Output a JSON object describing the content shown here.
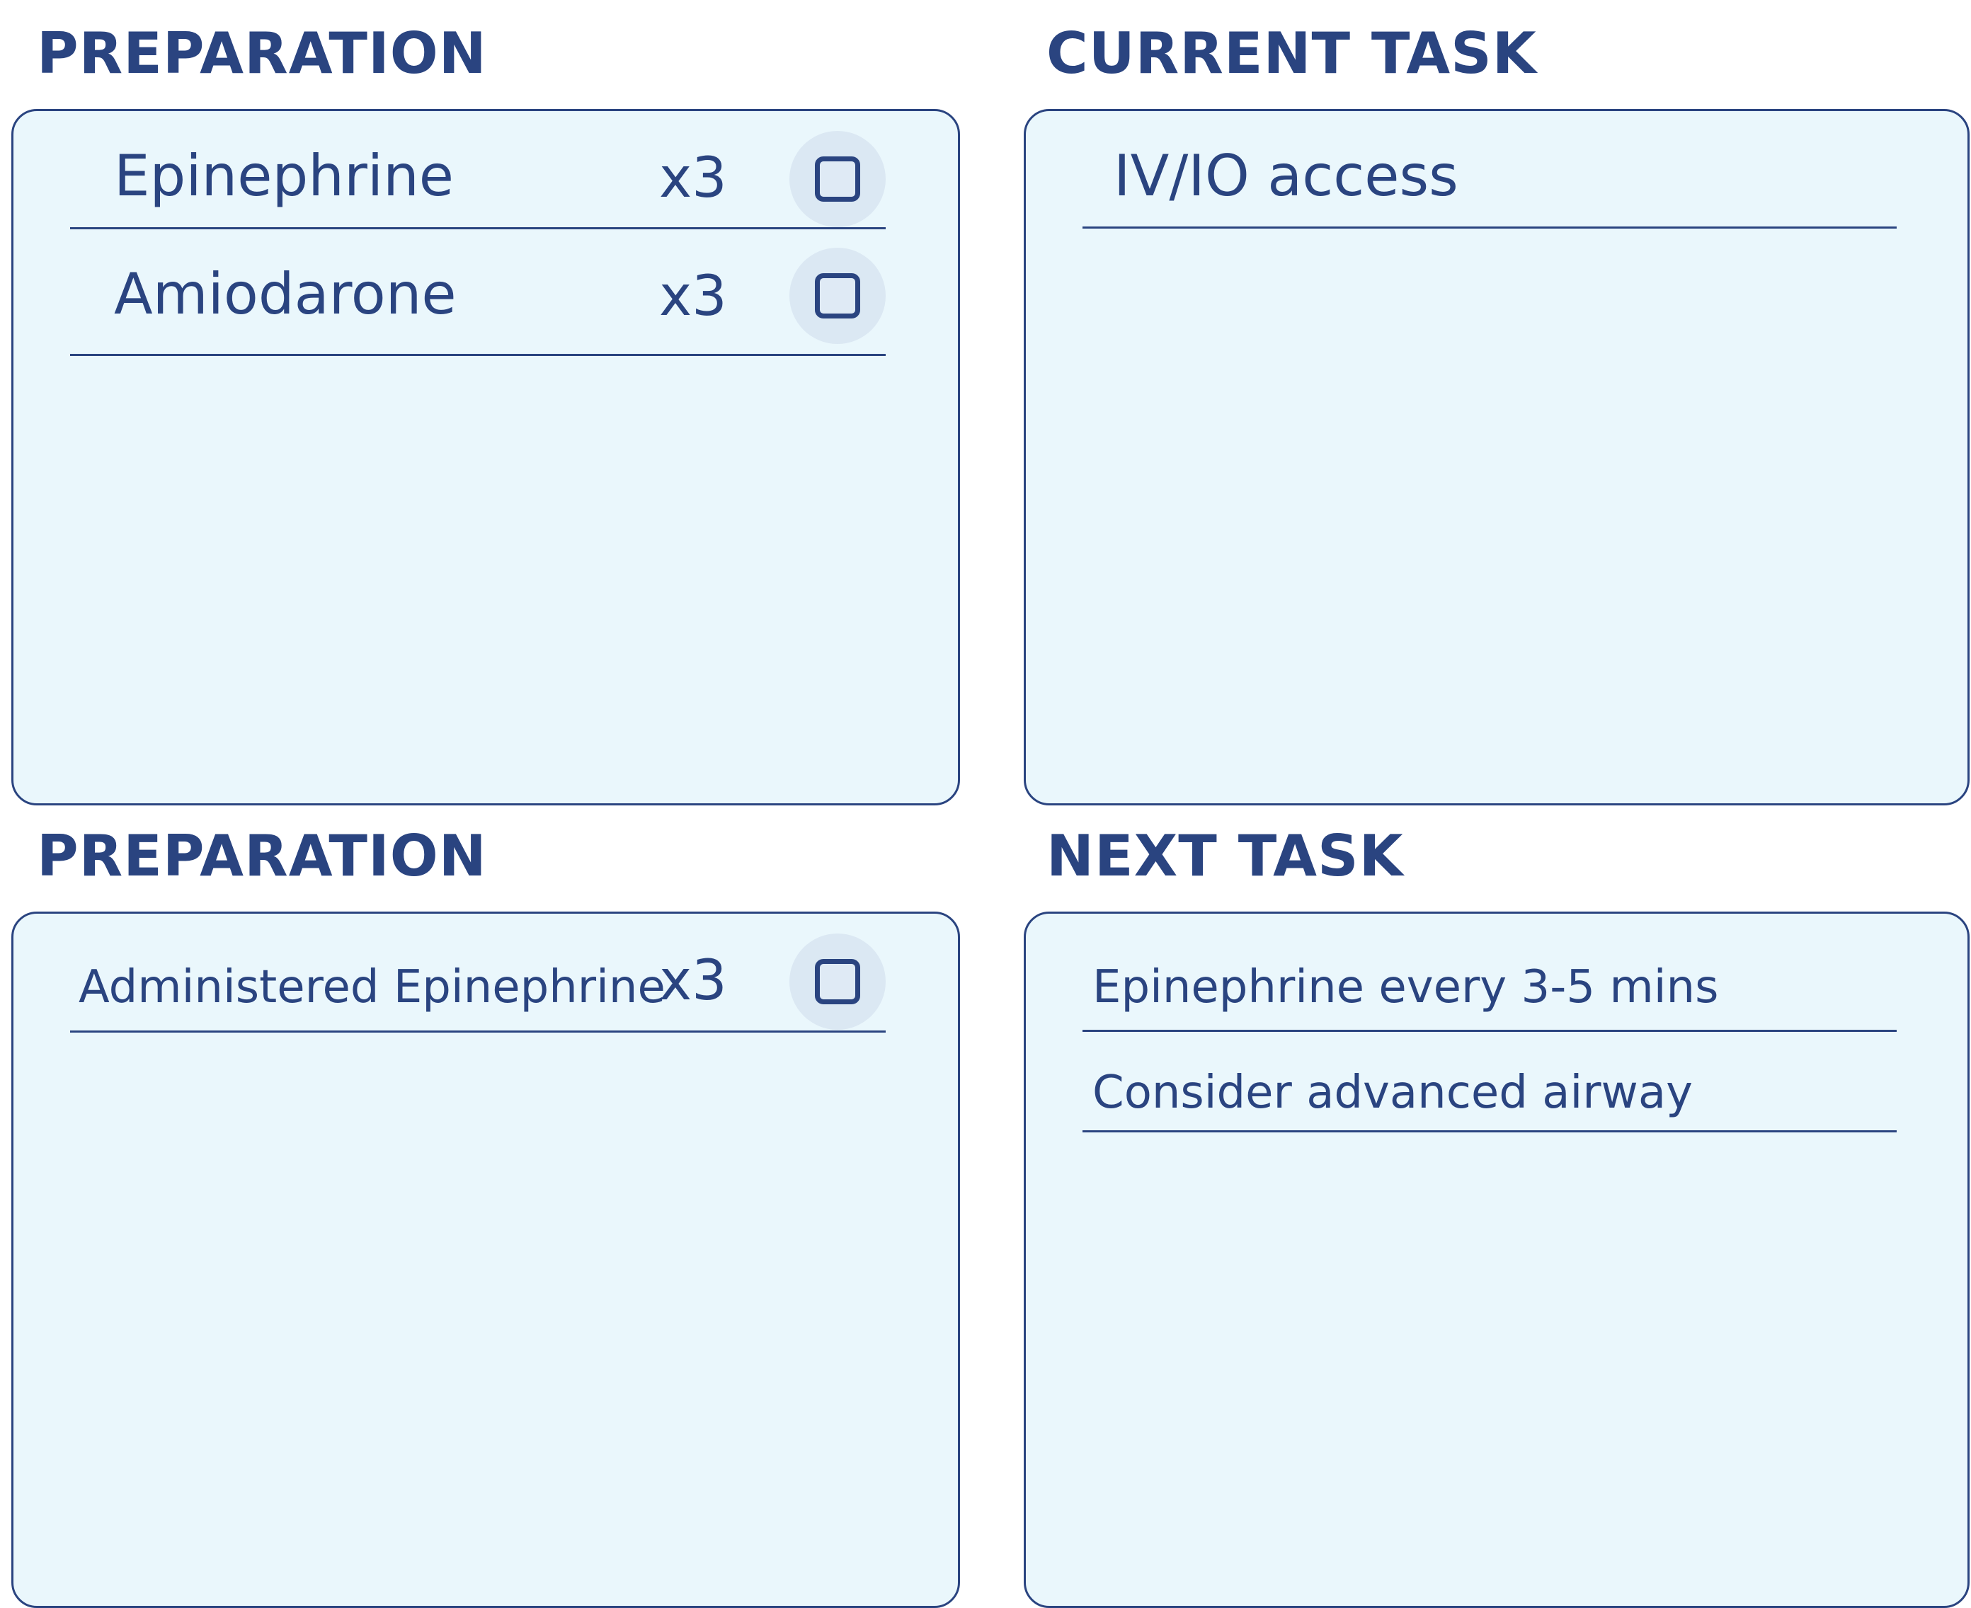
{
  "preparation_top": {
    "title": "PREPARATION",
    "items": [
      {
        "label": "Epinephrine",
        "count": "x3",
        "checked": false
      },
      {
        "label": "Amiodarone",
        "count": "x3",
        "checked": false
      }
    ]
  },
  "current_task": {
    "title": "CURRENT TASK",
    "items": [
      {
        "label": "IV/IO access"
      }
    ]
  },
  "preparation_bottom": {
    "title": "PREPARATION",
    "items": [
      {
        "label": "Administered Epinephrine",
        "count": "x3",
        "checked": false
      }
    ]
  },
  "next_task": {
    "title": "NEXT TASK",
    "items": [
      {
        "label": "Epinephrine every 3-5 mins"
      },
      {
        "label": "Consider advanced airway"
      }
    ]
  },
  "colors": {
    "primary_text": "#2a4480",
    "panel_bg": "#eaf7fc",
    "checkbox_halo": "#dbe8f3"
  },
  "icons": {
    "checkbox": "checkbox-unchecked-icon"
  }
}
